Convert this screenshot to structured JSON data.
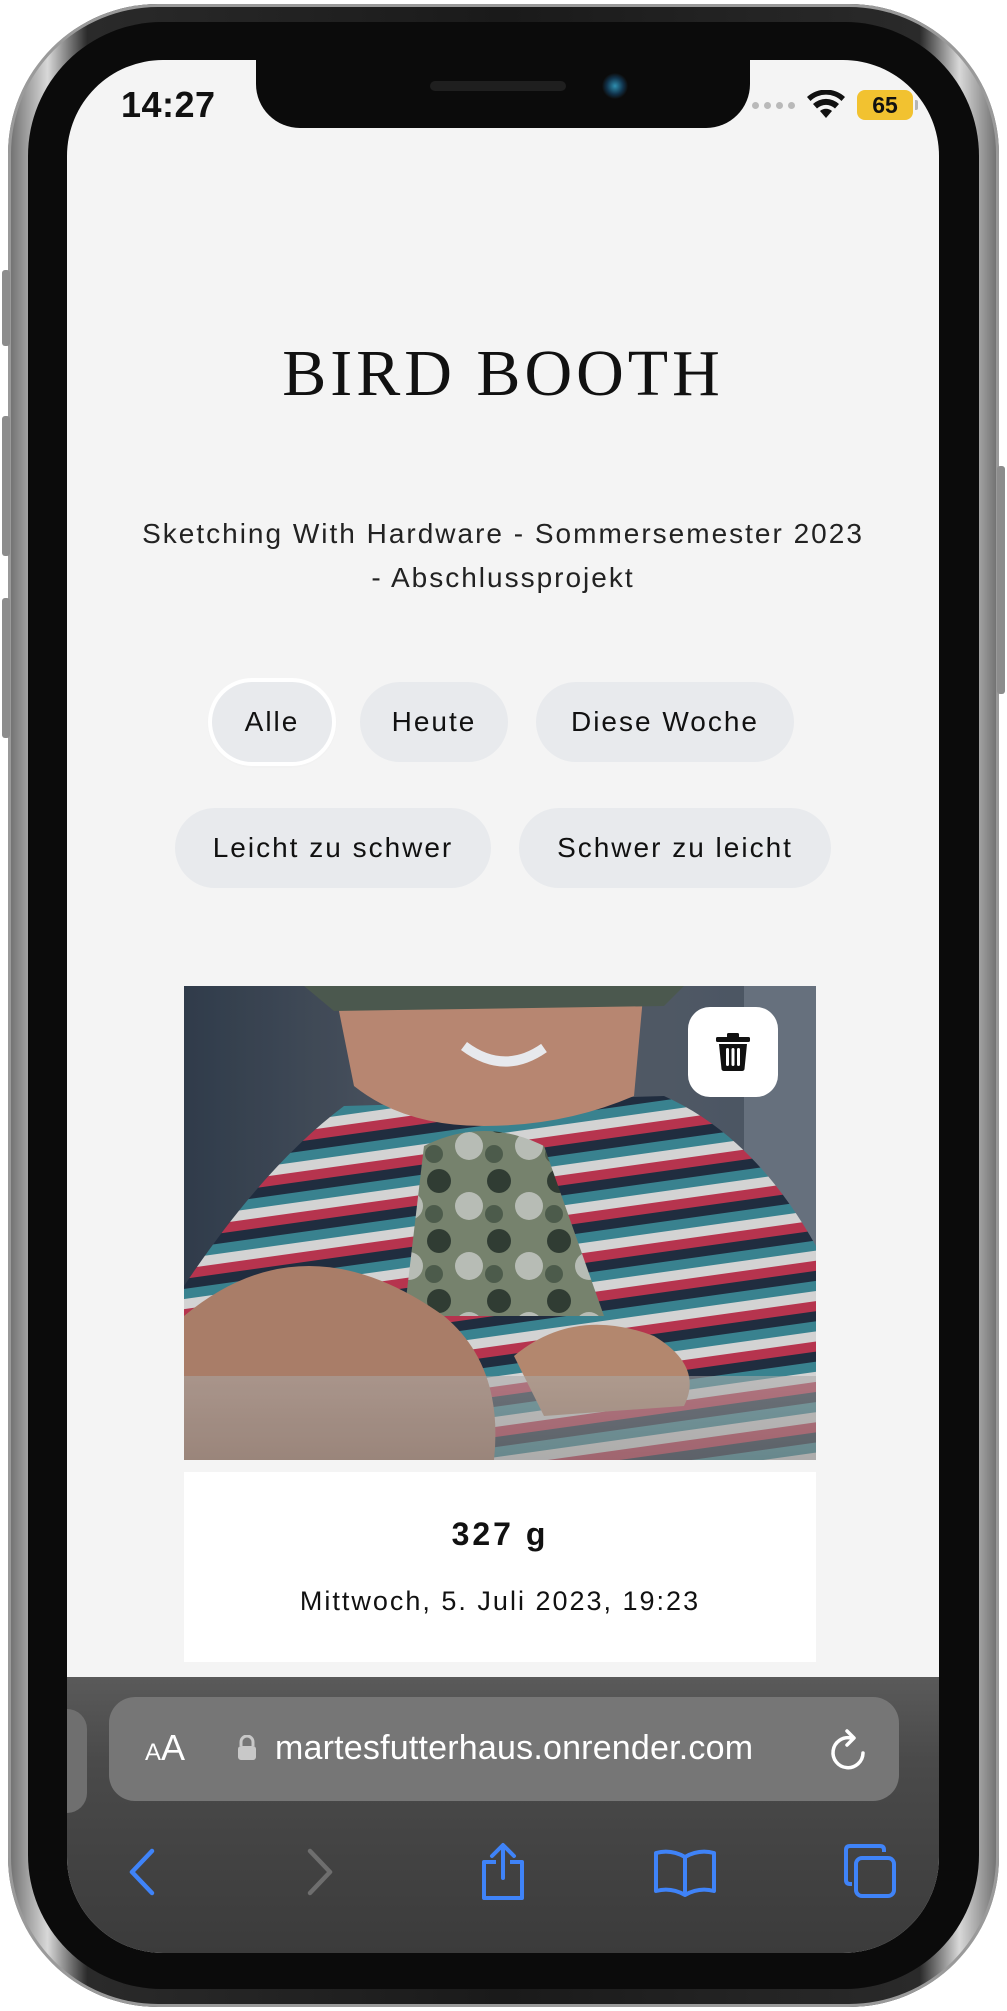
{
  "status_bar": {
    "time": "14:27",
    "battery": "65"
  },
  "page": {
    "title": "BIRD BOOTH",
    "subtitle": "Sketching With Hardware - Sommersemester 2023 - Abschlussprojekt"
  },
  "filters": {
    "row1": [
      {
        "label": "Alle",
        "active": true
      },
      {
        "label": "Heute",
        "active": false
      },
      {
        "label": "Diese Woche",
        "active": false
      }
    ],
    "row2": [
      {
        "label": "Leicht zu schwer",
        "active": false
      },
      {
        "label": "Schwer zu leicht",
        "active": false
      }
    ]
  },
  "entry": {
    "weight": "327 g",
    "timestamp": "Mittwoch, 5. Juli 2023, 19:23",
    "delete_icon": "trash-icon"
  },
  "browser": {
    "text_size_label_small": "A",
    "text_size_label_large": "A",
    "url": "martesfutterhaus.onrender.com",
    "accent_color": "#3f83f8",
    "icons": [
      "lock-icon",
      "reload-icon",
      "back-icon",
      "forward-icon",
      "share-icon",
      "bookmarks-icon",
      "tabs-icon"
    ]
  }
}
